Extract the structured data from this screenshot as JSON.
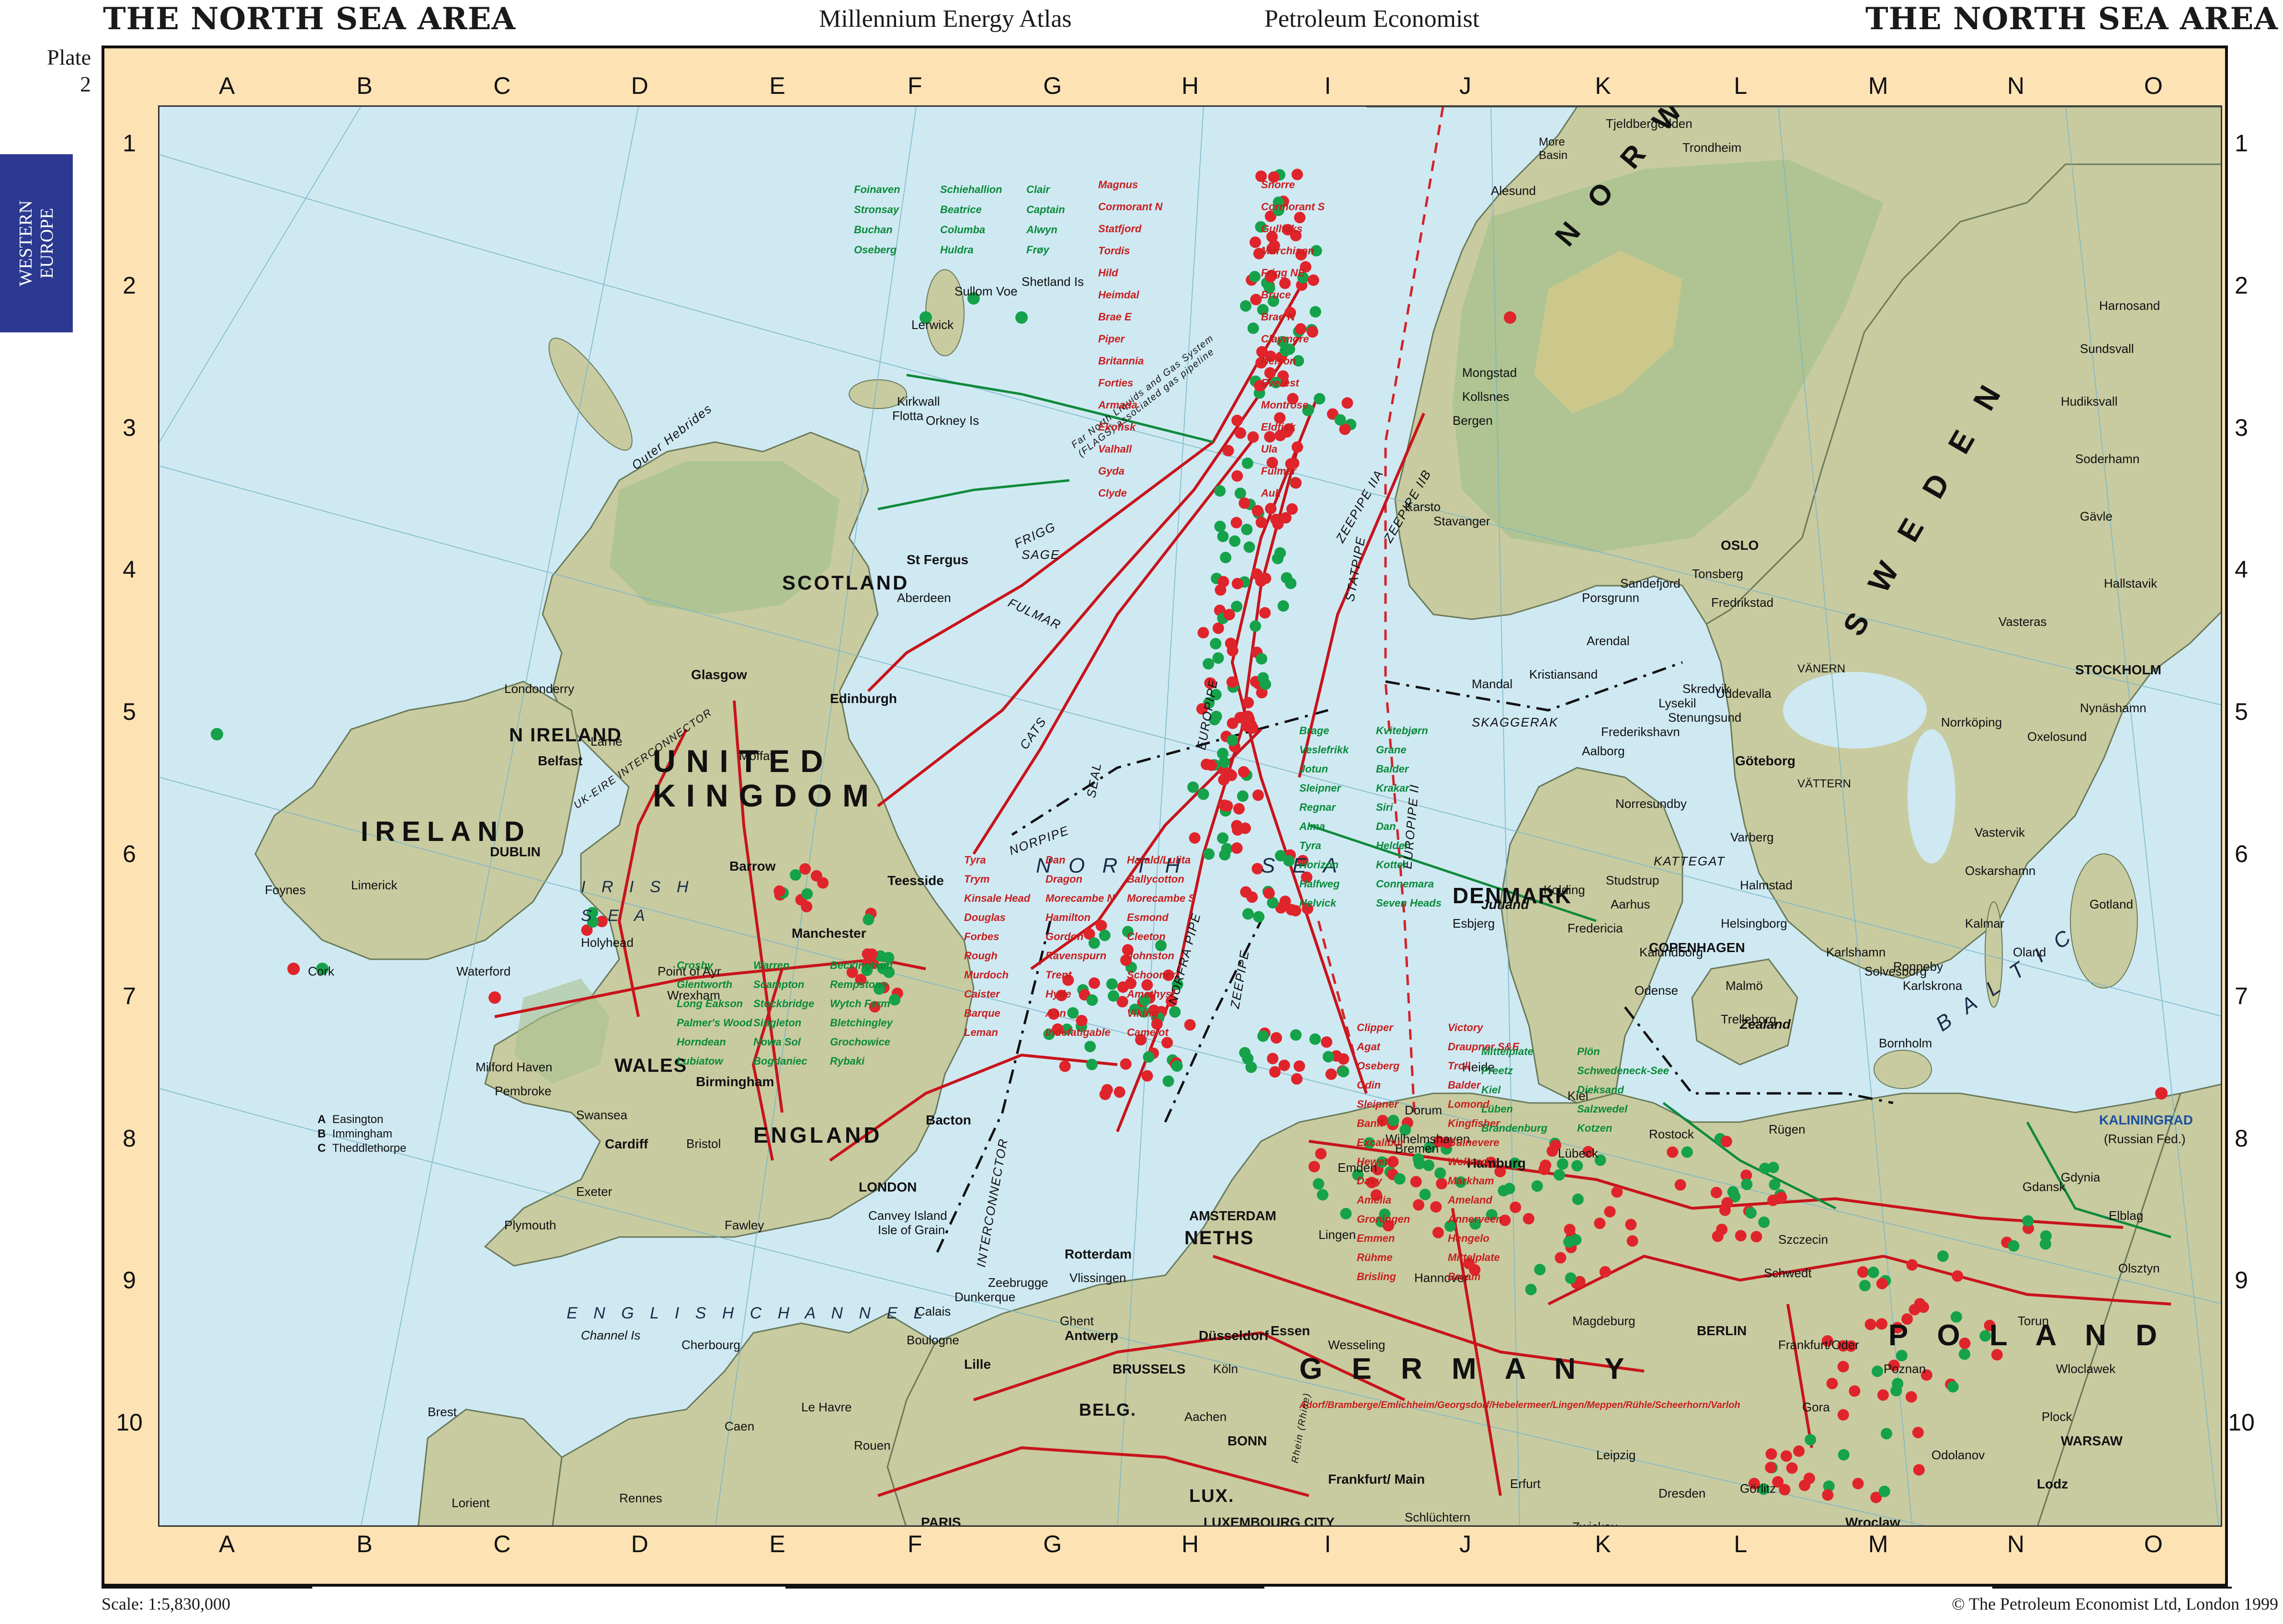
{
  "header": {
    "title_left": "THE NORTH SEA AREA",
    "atlas": "Millennium Energy Atlas",
    "publisher": "Petroleum Economist",
    "title_right": "THE NORTH SEA AREA"
  },
  "plate": {
    "word": "Plate",
    "number": "2"
  },
  "region_tab": {
    "line1": "WESTERN",
    "line2": "EUROPE"
  },
  "grid": {
    "columns": [
      "A",
      "B",
      "C",
      "D",
      "E",
      "F",
      "G",
      "H",
      "I",
      "J",
      "K",
      "L",
      "M",
      "N",
      "O"
    ],
    "rows": [
      "1",
      "2",
      "3",
      "4",
      "5",
      "6",
      "7",
      "8",
      "9",
      "10"
    ]
  },
  "colors": {
    "sea": "#cfe9f3",
    "land": "#c8cba0",
    "land_highlands": "#a9c28e",
    "mountains": "#d6c98a",
    "frame": "#fde2b4",
    "oil": "#e0242b",
    "gas": "#15a24a",
    "pipeline": "#c8141b",
    "gas_pipeline": "#0f8a3b",
    "boundary": "#111111",
    "median_line": "#d2232a",
    "region_tab": "#2b3990"
  },
  "countries": {
    "uk": [
      "UNITED",
      "KINGDOM"
    ],
    "ireland": "IRELAND",
    "n_ireland": "N IRELAND",
    "scotland": "SCOTLAND",
    "wales": "WALES",
    "england": "ENGLAND",
    "norway": "N O R W A Y",
    "sweden": "S W E D E N",
    "denmark": "DENMARK",
    "germany": "G E R M A N Y",
    "poland": "P O L A N D",
    "neths": "NETHS",
    "belg": "BELG.",
    "lux": "LUX."
  },
  "seas": {
    "north_sea": [
      "N O R T H",
      "S E A"
    ],
    "irish_sea": [
      "I R I S H",
      "S E A"
    ],
    "english_channel": "E N G L I S H   C H A N N E L",
    "baltic": "B A L T I C",
    "skaggerak": "SKAGGERAK",
    "kattegat": "KATTEGAT",
    "more_basin": [
      "More",
      "Basin"
    ],
    "outer_hebrides": "Outer Hebrides",
    "vanern": "VÄNERN",
    "vattern": "VÄTTERN"
  },
  "cities": {
    "oslo": "OSLO",
    "stockholm": "STOCKHOLM",
    "copenhagen": "COPENHAGEN",
    "dublin": "DUBLIN",
    "london": "LONDON",
    "amsterdam": "AMSTERDAM",
    "brussels": "BRUSSELS",
    "berlin": "BERLIN",
    "warsaw": "WARSAW",
    "paris": "PARIS",
    "bonn": "BONN",
    "luxembourg": "LUXEMBOURG CITY",
    "kaliningrad": "KALININGRAD",
    "russian_fed": "(Russian Fed.)",
    "glasgow": "Glasgow",
    "edinburgh": "Edinburgh",
    "aberdeen": "Aberdeen",
    "st_fergus": "St Fergus",
    "belfast": "Belfast",
    "manchester": "Manchester",
    "birmingham": "Birmingham",
    "bristol": "Bristol",
    "cardiff": "Cardiff",
    "exeter": "Exeter",
    "plymouth": "Plymouth",
    "teesside": "Teesside",
    "barrow": "Barrow",
    "bacton": "Bacton",
    "rotterdam": "Rotterdam",
    "antwerp": "Antwerp",
    "lille": "Lille",
    "hamburg": "Hamburg",
    "bremen": "Bremen",
    "hannover": "Hannover",
    "essen": "Essen",
    "dusseldorf": "Düsseldorf",
    "koln": "Köln",
    "frankfurt": "Frankfurt/ Main",
    "gdansk": "Gdansk",
    "lodz": "Lodz",
    "poznan": "Poznan",
    "wroclaw": "Wroclaw",
    "szczecin": "Szczecin",
    "gothenburg": "Göteborg",
    "malmo": "Malmö",
    "bergen": "Bergen",
    "stavanger": "Stavanger",
    "trondheim": "Trondheim",
    "kristiansand": "Kristiansand",
    "aalborg": "Aalborg",
    "esbjerg": "Esbjerg",
    "kiel": "Kiel",
    "rostock": "Rostock",
    "lubeck": "Lübeck",
    "le_havre": "Le Havre",
    "rouen": "Rouen",
    "caen": "Caen",
    "cherbourg": "Cherbourg",
    "brest": "Brest",
    "rennes": "Rennes",
    "lorient": "Lorient",
    "calais": "Calais",
    "dunkerque": "Dunkerque",
    "zeebrugge": "Zeebrugge",
    "boulogne": "Boulogne",
    "lerwick": "Lerwick",
    "sullom_voe": "Sullom Voe",
    "kirkwall": "Kirkwall",
    "flotta": "Flotta",
    "cork": "Cork",
    "waterford": "Waterford",
    "limerick": "Limerick",
    "foynes": "Foynes",
    "londonderry": "Londonderry",
    "larne": "Larne",
    "moffat": "Moffat",
    "holyhead": "Holyhead",
    "point_of_ayr": "Point of Ayr",
    "wrexham": "Wrexham",
    "milford_haven": "Milford Haven",
    "pembroke": "Pembroke",
    "swansea": "Swansea",
    "fawley": "Fawley",
    "isle_of_grain": "Isle of Grain",
    "canvey": "Canvey Island",
    "vlissingen": "Vlissingen",
    "mongstad": "Mongstad",
    "kollsnes": "Kollsnes",
    "karsto": "Karsto",
    "alesund": "Alesund",
    "mandal": "Mandal",
    "arendal": "Arendal",
    "porsgrunn": "Porsgrunn",
    "sandefjord": "Sandefjord",
    "tonsberg": "Tonsberg",
    "fredrikstad": "Fredrikstad",
    "lysekil": "Lysekil",
    "uddevalla": "Uddevalla",
    "stenungsund": "Stenungsund",
    "skredvik": "Skredvik",
    "varberg": "Varberg",
    "halmstad": "Halmstad",
    "helsingborg": "Helsingborg",
    "karlshamn": "Karlshamn",
    "trelleborg": "Trelleborg",
    "bornholm": "Bornholm",
    "gotland": "Gotland",
    "oland": "Oland",
    "kalmar": "Kalmar",
    "vastervik": "Vastervik",
    "oskarshamn": "Oskarshamn",
    "norrkoping": "Norrköping",
    "nynashamn": "Nynäshamn",
    "oxelosund": "Oxelosund",
    "vasteras": "Vasteras",
    "hallstavik": "Hallstavik",
    "gavle": "Gävle",
    "soderhamn": "Soderhamn",
    "hudiksvall": "Hudiksvall",
    "sundsvall": "Sundsvall",
    "harnosand": "Harnosand",
    "tjeldbergodden": "Tjeldbergodden",
    "gdynia": "Gdynia",
    "elblag": "Elblag",
    "torun": "Torun",
    "plock": "Plock",
    "wloclawek": "Wloclawek",
    "olsztyn": "Olsztyn",
    "rugen": "Rügen",
    "zealand": "Zealand",
    "jutland": "Jutland",
    "fredericia": "Fredericia",
    "kalundborg": "Kalundborg",
    "odense": "Odense",
    "studstrup": "Studstrup",
    "aarhus": "Aarhus",
    "kolding": "Kolding",
    "nogersund": "Nogersund",
    "solvesborg": "Solvesborg",
    "karlskrona": "Karlskrona",
    "ronneby": "Ronneby",
    "heide": "Heide",
    "wilhelmshaven": "Wilhelmshaven",
    "emden": "Emden",
    "dorum": "Dorum",
    "lingen": "Lingen",
    "wesseling": "Wesseling",
    "aachen": "Aachen",
    "schwedt": "Schwedt",
    "leipzig": "Leipzig",
    "dresden": "Dresden",
    "erfurt": "Erfurt",
    "zwickau": "Zwickau",
    "gorlitz": "Görlitz",
    "schlüchtern": "Schlüchtern",
    "magdeburg": "Magdeburg",
    "frankfurt_oder": "Frankfurt/Oder",
    "gora": "Gora",
    "odolanov": "Odolanov",
    "ghent": "Ghent",
    "channel_is": "Channel Is",
    "shetland_is": "Shetland Is",
    "orkney_is": "Orkney Is",
    "easington": "Easington",
    "immingham": "Immingham",
    "theddlethorpe": "Theddlethorpe",
    "oblonsnafjord": "Frederikshavn",
    "norresundby": "Norresundby"
  },
  "fields_oil": [
    "Magnus",
    "Snorre",
    "Cormorant N",
    "Cormorant S",
    "Statfjord",
    "Gullfaks",
    "Tordis",
    "Murchison",
    "Hild",
    "Frigg NE",
    "Heimdal",
    "Bruce",
    "Brae E",
    "Brae N",
    "Piper",
    "Claymore",
    "Britannia",
    "Nelson",
    "Forties",
    "Everest",
    "Armada",
    "Montrose",
    "Ekofisk",
    "Eldfisk",
    "Valhall",
    "Ula",
    "Gyda",
    "Fulmar",
    "Clyde",
    "Auk",
    "Tyra",
    "Dan",
    "Harald/Lulita",
    "Trym",
    "Dragon",
    "Ballycotton",
    "Kinsale Head",
    "Morecambe N",
    "Morecambe S",
    "Douglas",
    "Hamilton",
    "Esmond",
    "Forbes",
    "Gordon",
    "Cleeton",
    "Rough",
    "Ravenspurn",
    "Johnston",
    "Murdoch",
    "Trent",
    "Schooner",
    "Caister",
    "Hyde",
    "Amethyst",
    "Barque",
    "Ann",
    "Viking",
    "Leman",
    "Indefatigable",
    "Camelot",
    "Clipper",
    "Victory",
    "Agat",
    "Draupner S&E",
    "Oseberg",
    "Troll",
    "Odin",
    "Balder",
    "Sleipner",
    "Lomond",
    "Banff",
    "Kingfisher",
    "Excalibur",
    "Guinevere",
    "Hewett",
    "Welland",
    "Davy",
    "Markham",
    "Amelia",
    "Ameland",
    "Groningen",
    "Annerveen",
    "Emmen",
    "Hengelo",
    "Rühme",
    "Mittelplate",
    "Brisling",
    "Bream"
  ],
  "fields_gas": [
    "Foinaven",
    "Schiehallion",
    "Clair",
    "Stronsay",
    "Beatrice",
    "Captain",
    "Buchan",
    "Columba",
    "Alwyn",
    "Oseberg",
    "Huldra",
    "Frøy",
    "Brage",
    "Kvitebjørn",
    "Veslefrikk",
    "Grane",
    "Jotun",
    "Balder",
    "Sleipner",
    "Krakar",
    "Regnar",
    "Siri",
    "Alma",
    "Dan",
    "Tyra",
    "Helder",
    "Horizon",
    "Kotter",
    "Halfweg",
    "Connemara",
    "Helvick",
    "Seven Heads",
    "Crosby",
    "Warren",
    "Beckingham",
    "Glentworth",
    "Scampton",
    "Rempstone",
    "Long Eakson",
    "Stockbridge",
    "Wytch Farm",
    "Palmer's Wood",
    "Singleton",
    "Bletchingley",
    "Horndean",
    "Nowa Sol",
    "Grochowice",
    "Lubiatow",
    "Bogdaniec",
    "Rybaki",
    "Mittelplate",
    "Plön",
    "Preetz",
    "Schwedeneck-See",
    "Kiel",
    "Dieksand",
    "Lüben",
    "Salzwedel",
    "Brandenburg",
    "Kotzen"
  ],
  "pipelines": [
    "FRIGG",
    "SAGE",
    "FULMAR",
    "CATS",
    "NORPIPE",
    "SEAL",
    "STATPIPE",
    "ZEEPIPE",
    "ZEEPIPE IIA",
    "ZEEPIPE IIB",
    "EUROPIPE",
    "EUROPIPE II",
    "NORFRA PIPE",
    "INTERCONNECTOR",
    "UK-EIRE INTERCONNECTOR"
  ],
  "flags_label": "Far North Liquids and Gas System (FLAGS) associated gas pipeline",
  "terminals_key": [
    {
      "code": "A",
      "name": "Easington"
    },
    {
      "code": "B",
      "name": "Immingham"
    },
    {
      "code": "C",
      "name": "Theddlethorpe"
    }
  ],
  "german_fields_label": "Adorf/Bramberge/Emlichheim/Georgsdorf/Hebelermeer/Lingen/Meppen/Rühle/Scheerhorn/Varloh",
  "rhein_label": "Rhein (Rhine)",
  "footer": {
    "scale": "Scale: 1:5,830,000",
    "copyright": "© The Petroleum Economist Ltd, London 1999"
  }
}
